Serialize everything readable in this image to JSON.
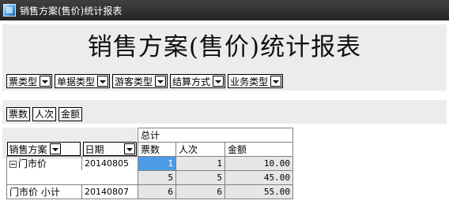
{
  "window": {
    "title": "销售方案(售价)统计报表"
  },
  "report": {
    "title": "销售方案(售价)统计报表"
  },
  "filter_fields": [
    {
      "label": "票类型"
    },
    {
      "label": "单据类型"
    },
    {
      "label": "游客类型"
    },
    {
      "label": "结算方式"
    },
    {
      "label": "业务类型"
    }
  ],
  "data_fields": [
    "票数",
    "人次",
    "金额"
  ],
  "row_fields": [
    {
      "label": "销售方案"
    },
    {
      "label": "日期"
    }
  ],
  "table": {
    "total_header": "总计",
    "columns": [
      "票数",
      "人次",
      "金额"
    ],
    "group": {
      "name": "门市价",
      "rows": [
        {
          "date": "20140805",
          "tickets": "1",
          "people": "1",
          "amount": "10.00"
        },
        {
          "date": "20140807",
          "tickets": "5",
          "people": "5",
          "amount": "45.00"
        }
      ]
    },
    "subtotal": {
      "label": "门市价 小计",
      "tickets": "6",
      "people": "6",
      "amount": "55.00"
    }
  }
}
